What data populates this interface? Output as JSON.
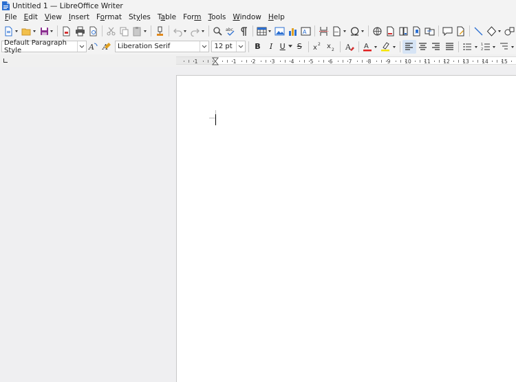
{
  "window": {
    "title": "Untitled 1 — LibreOffice Writer"
  },
  "menu": [
    {
      "label": "File",
      "key": "F",
      "rest": "ile"
    },
    {
      "label": "Edit",
      "key": "E",
      "rest": "dit"
    },
    {
      "label": "View",
      "key": "V",
      "rest": "iew"
    },
    {
      "label": "Insert",
      "key": "I",
      "rest": "nsert"
    },
    {
      "label": "Format",
      "key": "o",
      "pre": "F",
      "rest": "rmat"
    },
    {
      "label": "Styles",
      "key": "y",
      "pre": "St",
      "rest": "les"
    },
    {
      "label": "Table",
      "key": "a",
      "pre": "T",
      "rest": "ble"
    },
    {
      "label": "Form",
      "key": "m",
      "pre": "For",
      "rest": ""
    },
    {
      "label": "Tools",
      "key": "T",
      "rest": "ools"
    },
    {
      "label": "Window",
      "key": "W",
      "rest": "indow"
    },
    {
      "label": "Help",
      "key": "H",
      "rest": "elp"
    }
  ],
  "formatting": {
    "paragraph_style": "Default Paragraph Style",
    "font_name": "Liberation Serif",
    "font_size": "12 pt",
    "bold": "B",
    "italic": "I",
    "underline": "U",
    "strikethrough": "S"
  },
  "ruler": {
    "labels": [
      "1",
      "1",
      "2",
      "3",
      "4",
      "5",
      "6",
      "7",
      "8",
      "9",
      "10",
      "11",
      "12",
      "13",
      "14",
      "15"
    ]
  },
  "colors": {
    "accent": "#1e6fd9",
    "font_color": "#e02020",
    "highlight": "#f5e400"
  }
}
